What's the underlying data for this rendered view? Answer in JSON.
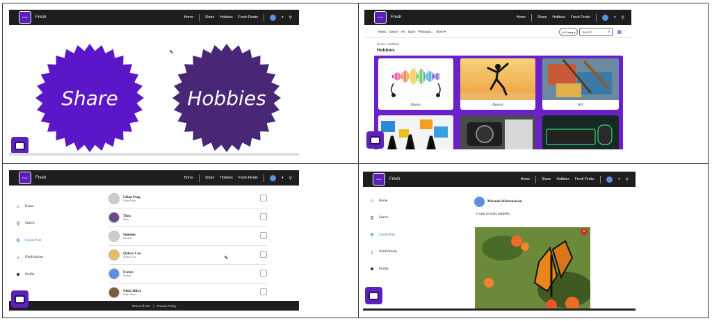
{
  "nav": {
    "brand": "Fresh",
    "logo_text": "Fresh",
    "links": [
      "Home",
      "Share",
      "Hobbies",
      "Fresh Finder"
    ]
  },
  "panel1": {
    "badge_left": "Share",
    "badge_right": "Hobbies",
    "colors": {
      "left": "#5b16c9",
      "right": "#472776"
    }
  },
  "panel2": {
    "categories": [
      "Music",
      "Dance",
      "Art",
      "Sport",
      "Photogra...",
      "More ▾"
    ],
    "category_select": "All Categ",
    "search_placeholder": "Search",
    "breadcrumb": "Home  /  Hobbies",
    "title": "Hobbies",
    "cards": [
      "Music",
      "Dance",
      "Art"
    ],
    "accent": "#6a22c8"
  },
  "sidebar": {
    "items": [
      "Home",
      "Search",
      "Create Post",
      "Notifications",
      "Profile"
    ]
  },
  "panel3": {
    "users": [
      {
        "name": "Lilian Pang",
        "handle": "Lilian Pang"
      },
      {
        "name": "Thea",
        "handle": "Thea"
      },
      {
        "name": "Summer",
        "handle": "Summer"
      },
      {
        "name": "Quincy Law",
        "handle": "Quincy Law"
      },
      {
        "name": "Evelyn",
        "handle": "Evelyn"
      },
      {
        "name": "Nikki Shiwo",
        "handle": "Nikki Shiwo"
      }
    ],
    "footer": {
      "terms": "Terms of Use",
      "divider": "|",
      "privacy": "Privacy Policy"
    }
  },
  "panel4": {
    "author": "Miranda Walterhausen",
    "text": "I went to study butterfly"
  }
}
